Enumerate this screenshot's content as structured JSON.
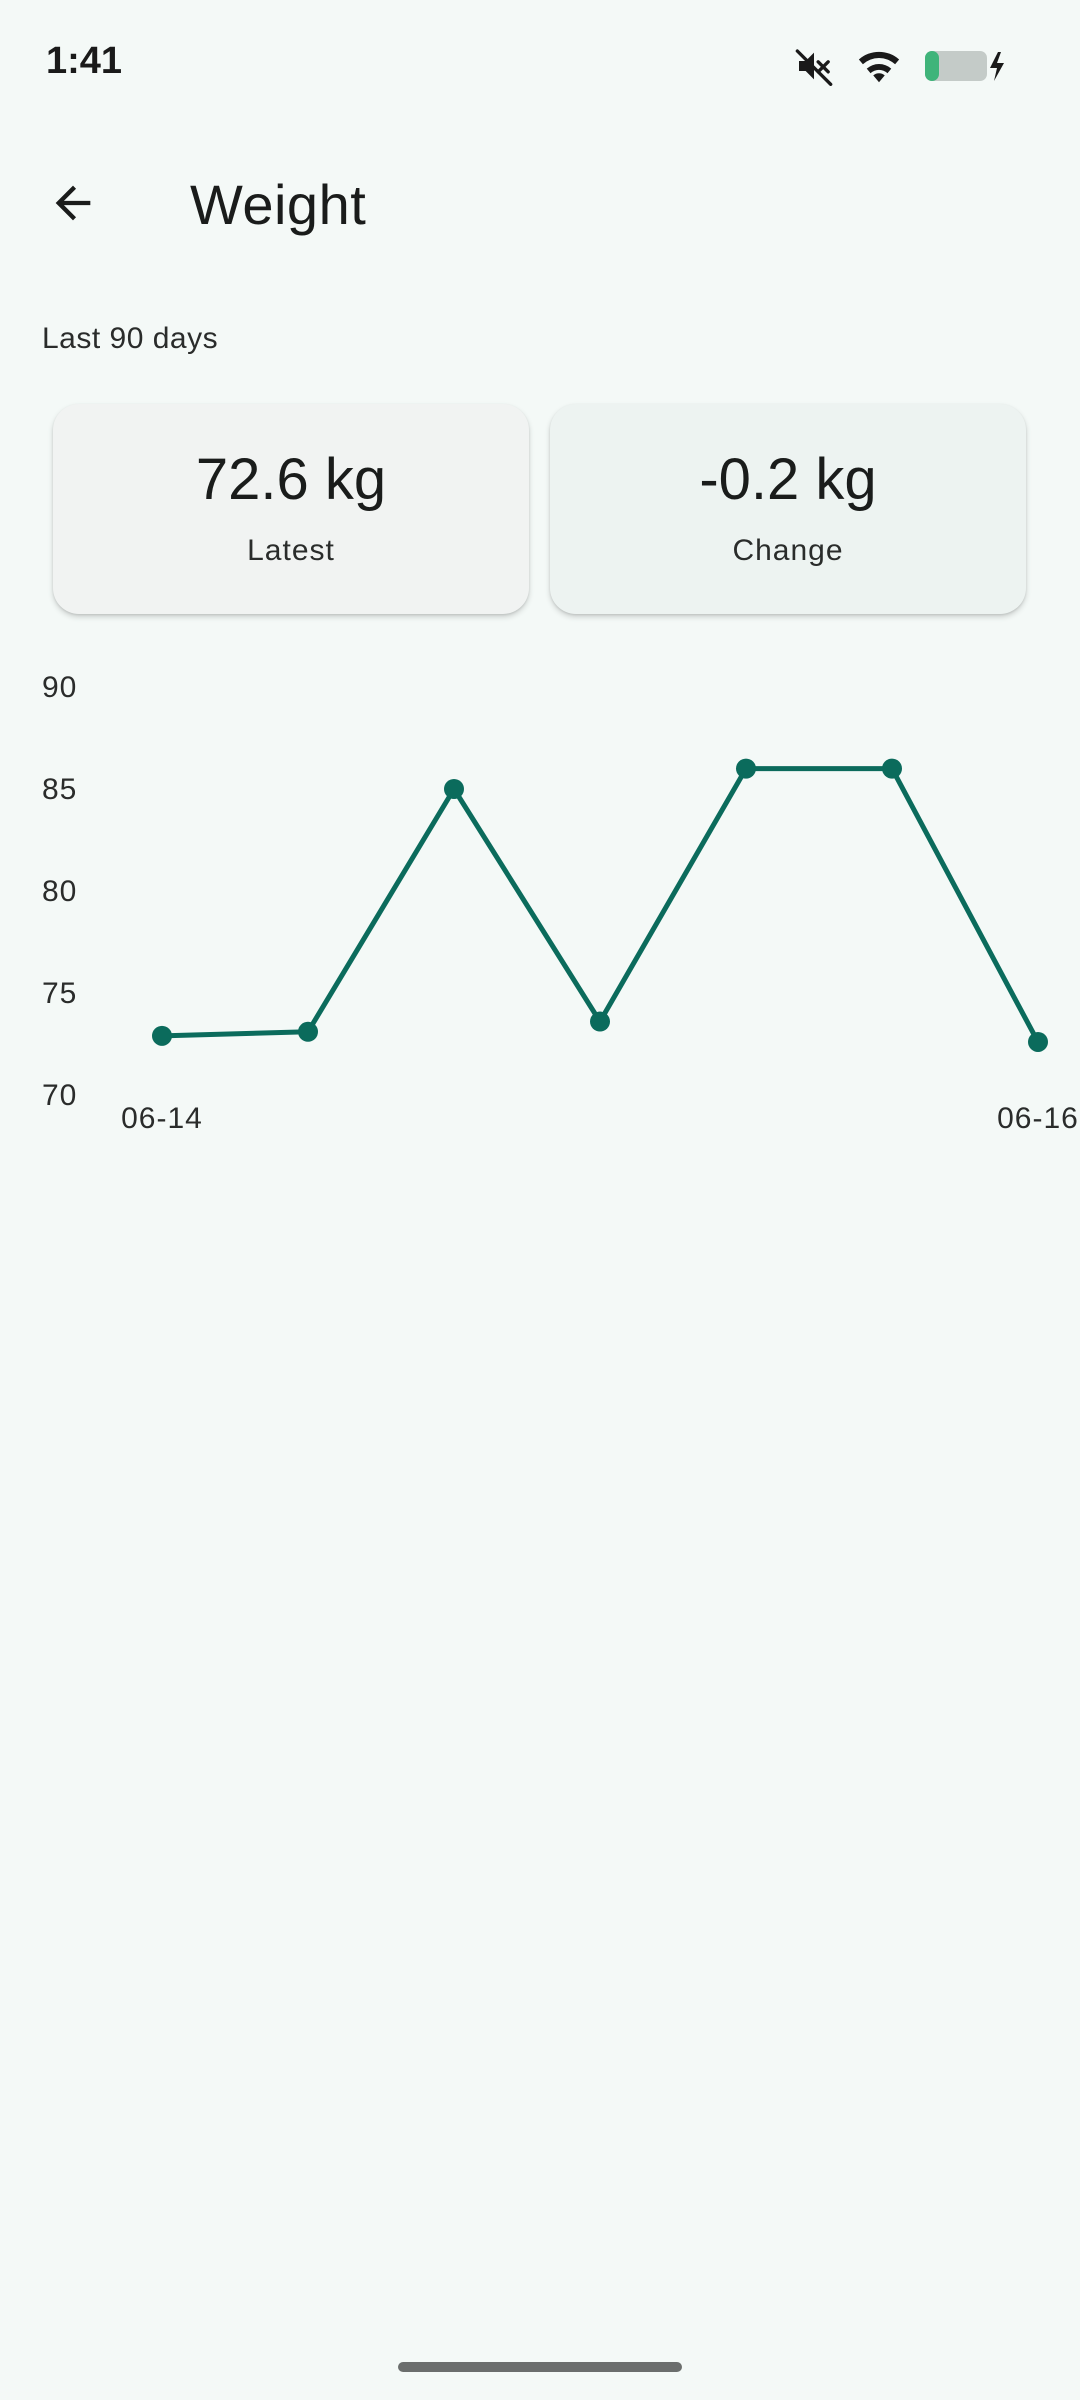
{
  "status_bar": {
    "time": "1:41",
    "icons": [
      "mute-icon",
      "wifi-icon",
      "battery-charging-icon"
    ],
    "battery_color": "#3fb47a"
  },
  "app_bar": {
    "title": "Weight",
    "back_icon": "arrow-back-icon"
  },
  "range_label": "Last 90 days",
  "stats": {
    "latest": {
      "value": "72.6 kg",
      "label": "Latest"
    },
    "change": {
      "value": "-0.2 kg",
      "label": "Change"
    }
  },
  "colors": {
    "accent": "#0b6b5c",
    "background": "#f4f9f7"
  },
  "chart_data": {
    "type": "line",
    "x": [
      0,
      1,
      2,
      3,
      4,
      5,
      6
    ],
    "x_tick_labels": [
      {
        "index": 0,
        "label": "06-14"
      },
      {
        "index": 6,
        "label": "06-16"
      }
    ],
    "y_ticks": [
      "90",
      "85",
      "80",
      "75",
      "70"
    ],
    "ylim": [
      70,
      90
    ],
    "series": [
      {
        "values": [
          72.9,
          73.1,
          85.0,
          73.6,
          86.0,
          86.0,
          72.6
        ]
      }
    ],
    "grid": false,
    "markers": true
  }
}
